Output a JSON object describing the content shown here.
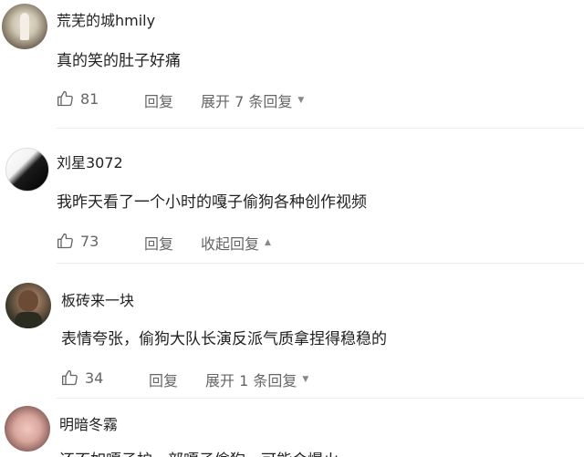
{
  "comments": [
    {
      "username": "荒芜的城hmily",
      "text": "真的笑的肚子好痛",
      "likes": "81",
      "reply_label": "回复",
      "expand_label": "展开 7 条回复",
      "caret": "▼"
    },
    {
      "username": "刘星3072",
      "text": "我昨天看了一个小时的嘎子偷狗各种创作视频",
      "likes": "73",
      "reply_label": "回复",
      "expand_label": "收起回复",
      "caret": "▲"
    },
    {
      "username": "板砖来一块",
      "text": "表情夸张，偷狗大队长演反派气质拿捏得稳稳的",
      "likes": "34",
      "reply_label": "回复",
      "expand_label": "展开 1 条回复",
      "caret": "▼"
    },
    {
      "username": "明暗冬霧",
      "text": "还不如嘎子护一部嘎子偷狗，可能会爆火"
    }
  ]
}
